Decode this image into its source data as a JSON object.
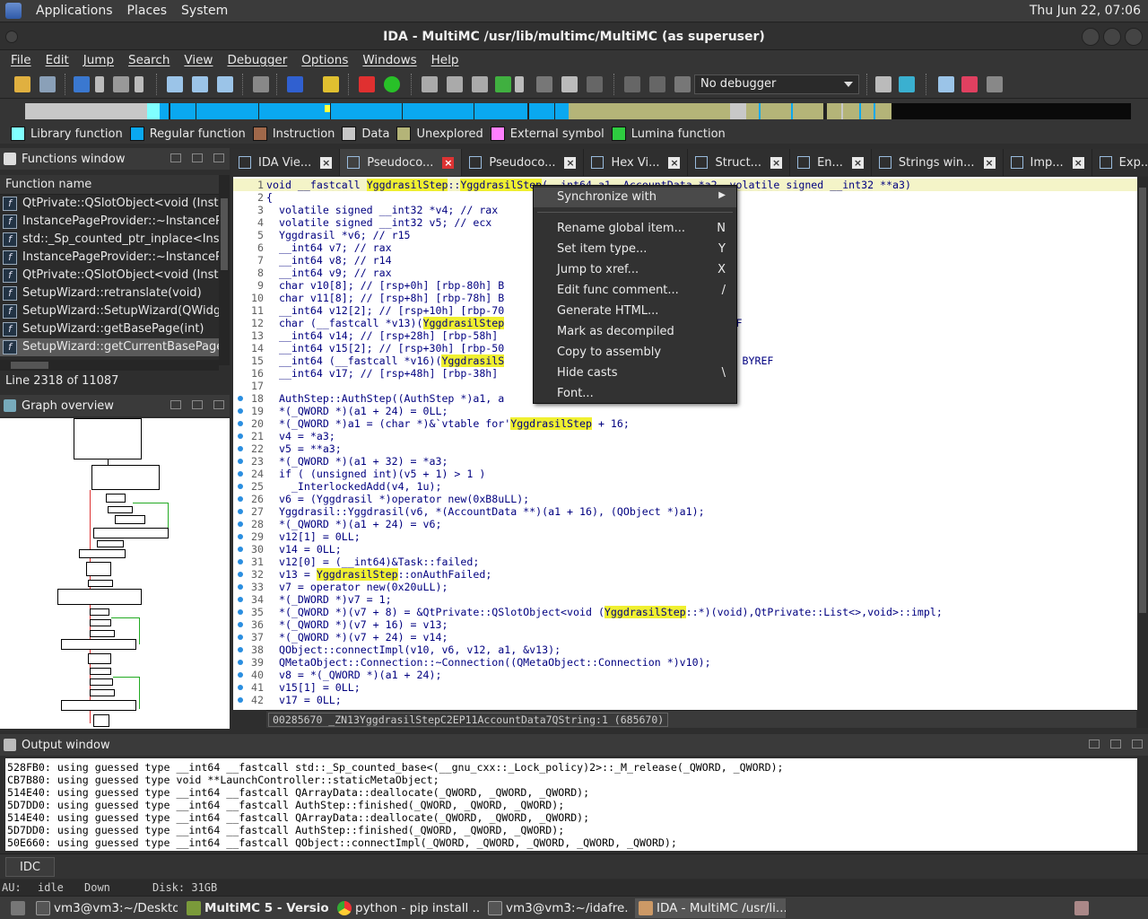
{
  "topbar": {
    "menu": [
      "Applications",
      "Places",
      "System"
    ],
    "clock": "Thu Jun 22, 07:06"
  },
  "window": {
    "title": "IDA - MultiMC /usr/lib/multimc/MultiMC (as superuser)"
  },
  "menubar": [
    "File",
    "Edit",
    "Jump",
    "Search",
    "View",
    "Debugger",
    "Options",
    "Windows",
    "Help"
  ],
  "toolbar": {
    "debugger_select": "No debugger"
  },
  "legend": [
    {
      "label": "Library function",
      "color": "#80ffff"
    },
    {
      "label": "Regular function",
      "color": "#0aa8f0"
    },
    {
      "label": "Instruction",
      "color": "#a0684a"
    },
    {
      "label": "Data",
      "color": "#c8c8c8"
    },
    {
      "label": "Unexplored",
      "color": "#b4b478"
    },
    {
      "label": "External symbol",
      "color": "#ff80ff"
    },
    {
      "label": "Lumina function",
      "color": "#2ecc40"
    }
  ],
  "functions_window": {
    "title": "Functions window",
    "column": "Function name",
    "items": [
      "QtPrivate::QSlotObject<void (Instance",
      "InstancePageProvider::~InstancePage",
      "std::_Sp_counted_ptr_inplace<Instan",
      "InstancePageProvider::~InstancePage",
      "QtPrivate::QSlotObject<void (Instance",
      "SetupWizard::retranslate(void)",
      "SetupWizard::SetupWizard(QWidget",
      "SetupWizard::getBasePage(int)",
      "SetupWizard::getCurrentBasePage(vo"
    ],
    "line_info": "Line 2318 of 11087"
  },
  "graph_overview": {
    "title": "Graph overview"
  },
  "tabs": [
    "IDA Vie...",
    "Pseudoco...",
    "Pseudoco...",
    "Hex Vi...",
    "Struct...",
    "En...",
    "Strings win...",
    "Imp...",
    "Exp..."
  ],
  "code": {
    "lines": [
      {
        "n": "1",
        "dot": false,
        "text": "void __fastcall YggdrasilStep::YggdrasilStep(__int64 a1, AccountData *a2, volatile signed __int32 **a3)"
      },
      {
        "n": "2",
        "dot": false,
        "text": "{"
      },
      {
        "n": "3",
        "dot": false,
        "text": "  volatile signed __int32 *v4; // rax"
      },
      {
        "n": "4",
        "dot": false,
        "text": "  volatile signed __int32 v5; // ecx"
      },
      {
        "n": "5",
        "dot": false,
        "text": "  Yggdrasil *v6; // r15"
      },
      {
        "n": "6",
        "dot": false,
        "text": "  __int64 v7; // rax"
      },
      {
        "n": "7",
        "dot": false,
        "text": "  __int64 v8; // r14"
      },
      {
        "n": "8",
        "dot": false,
        "text": "  __int64 v9; // rax"
      },
      {
        "n": "9",
        "dot": false,
        "text": "  char v10[8]; // [rsp+0h] [rbp-80h] B"
      },
      {
        "n": "10",
        "dot": false,
        "text": "  char v11[8]; // [rsp+8h] [rbp-78h] B"
      },
      {
        "n": "11",
        "dot": false,
        "text": "  __int64 v12[2]; // [rsp+10h] [rbp-70"
      },
      {
        "n": "12",
        "dot": false,
        "text": "  char (__fastcall *v13)(YggdrasilStep                                 BYREF"
      },
      {
        "n": "13",
        "dot": false,
        "text": "  __int64 v14; // [rsp+28h] [rbp-58h]"
      },
      {
        "n": "14",
        "dot": false,
        "text": "  __int64 v15[2]; // [rsp+30h] [rbp-50"
      },
      {
        "n": "15",
        "dot": false,
        "text": "  __int64 (__fastcall *v16)(YggdrasilS                            [rbp-40h] BYREF"
      },
      {
        "n": "16",
        "dot": false,
        "text": "  __int64 v17; // [rsp+48h] [rbp-38h]"
      },
      {
        "n": "17",
        "dot": false,
        "text": ""
      },
      {
        "n": "18",
        "dot": true,
        "text": "  AuthStep::AuthStep((AuthStep *)a1, a"
      },
      {
        "n": "19",
        "dot": true,
        "text": "  *(_QWORD *)(a1 + 24) = 0LL;"
      },
      {
        "n": "20",
        "dot": true,
        "text": "  *(_QWORD *)a1 = (char *)&`vtable for'YggdrasilStep + 16;"
      },
      {
        "n": "21",
        "dot": true,
        "text": "  v4 = *a3;"
      },
      {
        "n": "22",
        "dot": true,
        "text": "  v5 = **a3;"
      },
      {
        "n": "23",
        "dot": true,
        "text": "  *(_QWORD *)(a1 + 32) = *a3;"
      },
      {
        "n": "24",
        "dot": true,
        "text": "  if ( (unsigned int)(v5 + 1) > 1 )"
      },
      {
        "n": "25",
        "dot": true,
        "text": "    _InterlockedAdd(v4, 1u);"
      },
      {
        "n": "26",
        "dot": true,
        "text": "  v6 = (Yggdrasil *)operator new(0xB8uLL);"
      },
      {
        "n": "27",
        "dot": true,
        "text": "  Yggdrasil::Yggdrasil(v6, *(AccountData **)(a1 + 16), (QObject *)a1);"
      },
      {
        "n": "28",
        "dot": true,
        "text": "  *(_QWORD *)(a1 + 24) = v6;"
      },
      {
        "n": "29",
        "dot": true,
        "text": "  v12[1] = 0LL;"
      },
      {
        "n": "30",
        "dot": true,
        "text": "  v14 = 0LL;"
      },
      {
        "n": "31",
        "dot": true,
        "text": "  v12[0] = (__int64)&Task::failed;"
      },
      {
        "n": "32",
        "dot": true,
        "text": "  v13 = YggdrasilStep::onAuthFailed;"
      },
      {
        "n": "33",
        "dot": true,
        "text": "  v7 = operator new(0x20uLL);"
      },
      {
        "n": "34",
        "dot": true,
        "text": "  *(_DWORD *)v7 = 1;"
      },
      {
        "n": "35",
        "dot": true,
        "text": "  *(_QWORD *)(v7 + 8) = &QtPrivate::QSlotObject<void (YggdrasilStep::*)(void),QtPrivate::List<>,void>::impl;"
      },
      {
        "n": "36",
        "dot": true,
        "text": "  *(_QWORD *)(v7 + 16) = v13;"
      },
      {
        "n": "37",
        "dot": true,
        "text": "  *(_QWORD *)(v7 + 24) = v14;"
      },
      {
        "n": "38",
        "dot": true,
        "text": "  QObject::connectImpl(v10, v6, v12, a1, &v13);"
      },
      {
        "n": "39",
        "dot": true,
        "text": "  QMetaObject::Connection::~Connection((QMetaObject::Connection *)v10);"
      },
      {
        "n": "40",
        "dot": true,
        "text": "  v8 = *(_QWORD *)(a1 + 24);"
      },
      {
        "n": "41",
        "dot": true,
        "text": "  v15[1] = 0LL;"
      },
      {
        "n": "42",
        "dot": true,
        "text": "  v17 = 0LL;"
      }
    ],
    "status": "00285670 _ZN13YggdrasilStepC2EP11AccountData7QString:1 (685670)"
  },
  "context_menu": [
    {
      "label": "Synchronize with",
      "key": "▶"
    },
    {
      "label": "Rename global item...",
      "key": "N"
    },
    {
      "label": "Set item type...",
      "key": "Y"
    },
    {
      "label": "Jump to xref...",
      "key": "X"
    },
    {
      "label": "Edit func comment...",
      "key": "/"
    },
    {
      "label": "Generate HTML...",
      "key": ""
    },
    {
      "label": "Mark as decompiled",
      "key": ""
    },
    {
      "label": "Copy to assembly",
      "key": ""
    },
    {
      "label": "Hide casts",
      "key": "\\"
    },
    {
      "label": "Font...",
      "key": ""
    }
  ],
  "output_window": {
    "title": "Output window",
    "lines": [
      "528FB0: using guessed type __int64 __fastcall std::_Sp_counted_base<(__gnu_cxx::_Lock_policy)2>::_M_release(_QWORD, _QWORD);",
      "CB7B80: using guessed type void **LaunchController::staticMetaObject;",
      "514E40: using guessed type __int64 __fastcall QArrayData::deallocate(_QWORD, _QWORD, _QWORD);",
      "5D7DD0: using guessed type __int64 __fastcall AuthStep::finished(_QWORD, _QWORD, _QWORD);",
      "514E40: using guessed type __int64 __fastcall QArrayData::deallocate(_QWORD, _QWORD, _QWORD);",
      "5D7DD0: using guessed type __int64 __fastcall AuthStep::finished(_QWORD, _QWORD, _QWORD);",
      "50E660: using guessed type __int64 __fastcall QObject::connectImpl(_QWORD, _QWORD, _QWORD, _QWORD, _QWORD);"
    ]
  },
  "idc_button": "IDC",
  "statusbar": {
    "au": "AU:",
    "au_state": "idle",
    "direction": "Down",
    "disk": "Disk: 31GB"
  },
  "taskbar": [
    "vm3@vm3:~/Desktop",
    "MultiMC 5 - Versio...",
    "python - pip install ...",
    "vm3@vm3:~/idafre...",
    "IDA - MultiMC /usr/li..."
  ]
}
